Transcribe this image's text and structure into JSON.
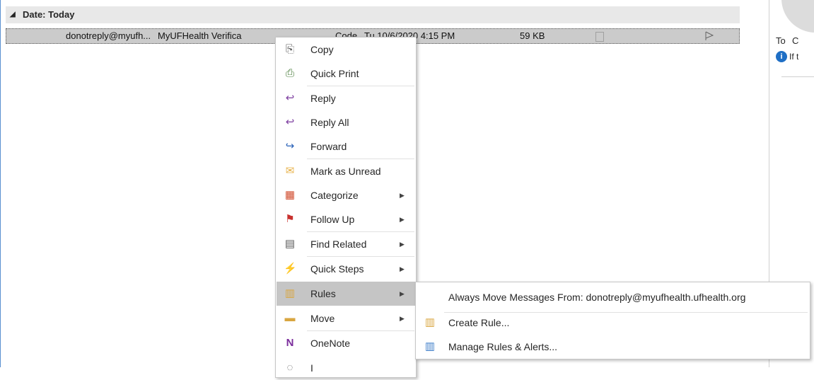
{
  "message_list": {
    "group_header": "Date: Today",
    "collapse_glyph": "◢",
    "row": {
      "from": "donotreply@myufh...",
      "subject": "MyUFHealth Verifica",
      "subject_tail": "Code",
      "received": "Tu 10/6/2020 4:15 PM",
      "size": "59 KB"
    }
  },
  "reading_pane": {
    "to_label": "To",
    "to_value": "C",
    "info_text": "If t"
  },
  "context_menu": {
    "items": [
      {
        "label": "Copy",
        "icon": "copy-icon",
        "glyph": "⎘",
        "color": "#5b5b5b"
      },
      {
        "label": "Quick Print",
        "icon": "printer-icon",
        "glyph": "⎙",
        "color": "#4a7c3b"
      },
      {
        "label": "Reply",
        "icon": "reply-icon",
        "glyph": "↩",
        "color": "#7e3fa0"
      },
      {
        "label": "Reply All",
        "icon": "reply-all-icon",
        "glyph": "↩",
        "color": "#7e3fa0"
      },
      {
        "label": "Forward",
        "icon": "forward-icon",
        "glyph": "↪",
        "color": "#2a62b8"
      },
      {
        "label": "Mark as Unread",
        "icon": "envelope-icon",
        "glyph": "✉",
        "color": "#e8b24a"
      },
      {
        "label": "Categorize",
        "icon": "categorize-icon",
        "glyph": "▦",
        "color": "#d04b2c"
      },
      {
        "label": "Follow Up",
        "icon": "flag-icon",
        "glyph": "⚑",
        "color": "#c8312e"
      },
      {
        "label": "Find Related",
        "icon": "find-related-icon",
        "glyph": "▤",
        "color": "#5b5b5b"
      },
      {
        "label": "Quick Steps",
        "icon": "lightning-icon",
        "glyph": "⚡",
        "color": "#f0c02e"
      },
      {
        "label": "Rules",
        "icon": "rules-icon",
        "glyph": "▥",
        "color": "#d9a640"
      },
      {
        "label": "Move",
        "icon": "move-folder-icon",
        "glyph": "▬",
        "color": "#d9a640"
      },
      {
        "label": "OneNote",
        "icon": "onenote-icon",
        "glyph": "N",
        "color": "#7b2d9c"
      },
      {
        "label": "I",
        "icon": "ignore-icon",
        "glyph": "◌",
        "color": "#5b5b5b"
      }
    ]
  },
  "rules_submenu": {
    "items": [
      {
        "label": "Always Move Messages From: donotreply@myufhealth.ufhealth.org",
        "icon": "",
        "glyph": "",
        "color": "#262626"
      },
      {
        "label": "Create Rule...",
        "icon": "create-rule-icon",
        "glyph": "▥",
        "color": "#d9a640"
      },
      {
        "label": "Manage Rules & Alerts...",
        "icon": "manage-rules-icon",
        "glyph": "▥",
        "color": "#3a7bc8"
      }
    ]
  }
}
